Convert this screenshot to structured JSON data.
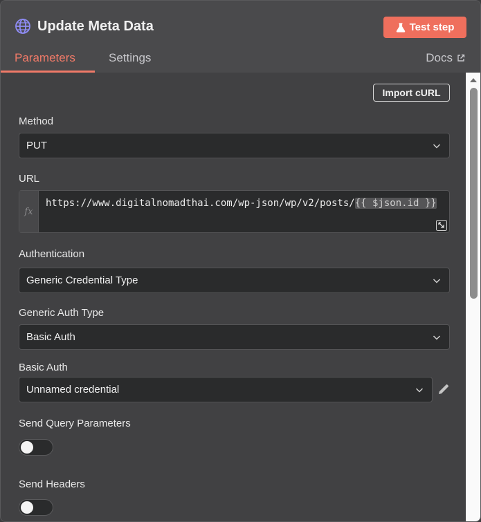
{
  "header": {
    "title": "Update Meta Data",
    "node_icon": "globe-icon",
    "test_button": "Test step",
    "test_button_icon": "flask-icon"
  },
  "tabs": {
    "parameters": "Parameters",
    "settings": "Settings",
    "docs": "Docs",
    "active": "Parameters"
  },
  "import_curl": "Import cURL",
  "fields": {
    "method": {
      "label": "Method",
      "value": "PUT"
    },
    "url": {
      "label": "URL",
      "fx": "fx",
      "static_part": "https://www.digitalnomadthai.com/wp-json/wp/v2/posts/",
      "expression_part": "{{ $json.id }}"
    },
    "authentication": {
      "label": "Authentication",
      "value": "Generic Credential Type"
    },
    "generic_auth_type": {
      "label": "Generic Auth Type",
      "value": "Basic Auth"
    },
    "basic_auth": {
      "label": "Basic Auth",
      "value": "Unnamed credential"
    },
    "send_query": {
      "label": "Send Query Parameters",
      "enabled": false
    },
    "send_headers": {
      "label": "Send Headers",
      "enabled": false
    }
  },
  "colors": {
    "accent": "#ef6f5d",
    "tab_active": "#f07a68",
    "panel_bg": "#414143",
    "input_bg": "#2a2b2c"
  }
}
